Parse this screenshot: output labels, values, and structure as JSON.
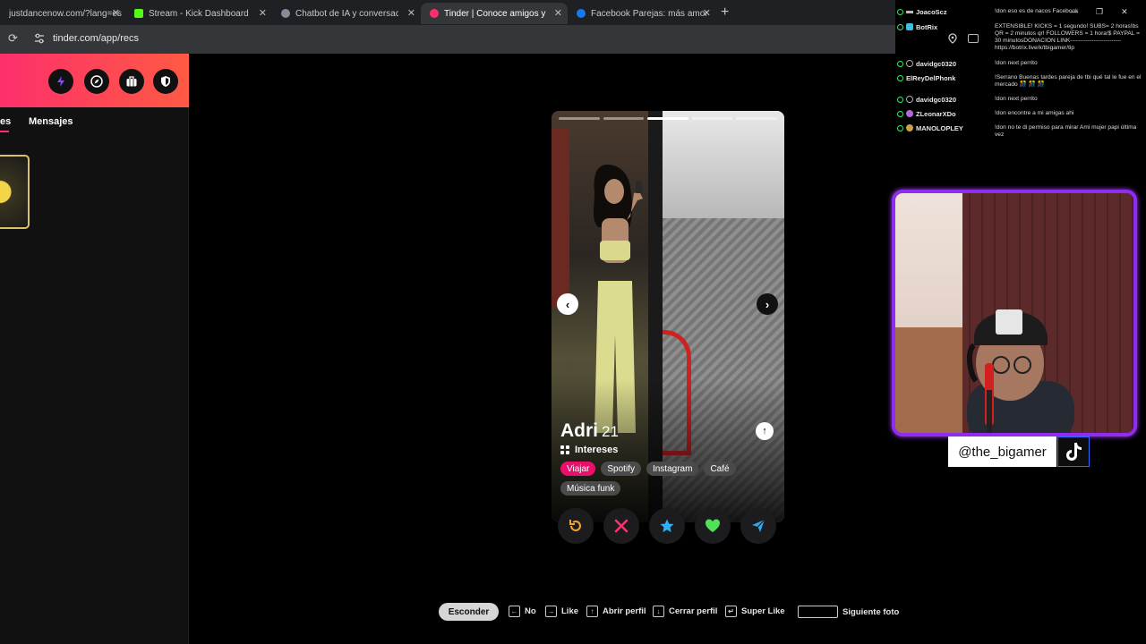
{
  "browser": {
    "tabs": [
      {
        "title": "justdancenow.com/?lang=es",
        "active": false
      },
      {
        "title": "Stream - Kick Dashboard",
        "active": false
      },
      {
        "title": "Chatbot de IA y conversaciones",
        "active": false
      },
      {
        "title": "Tinder | Conoce amigos y gente",
        "active": true
      },
      {
        "title": "Facebook Parejas: más amor",
        "active": false
      }
    ],
    "url": "tinder.com/app/recs"
  },
  "sidebar": {
    "tab_matches": "es",
    "tab_messages": "Mensajes"
  },
  "profile": {
    "name": "Adri",
    "age": "21",
    "interests_label": "Intereses",
    "interests": [
      "Viajar",
      "Spotify",
      "Instagram",
      "Café",
      "Música funk"
    ],
    "photo_count": 5,
    "current_photo": 3
  },
  "shortcuts": {
    "hide": "Esconder",
    "items": [
      "No",
      "Like",
      "Abrir perfil",
      "Cerrar perfil",
      "Super Like",
      "Siguiente foto"
    ]
  },
  "chat": {
    "messages": [
      {
        "user": "JoacoScz",
        "msg": "!don eso es de nacos Facebook"
      },
      {
        "user": "BotRix",
        "msg": "EXTENSIBLE! KICKS = 1 segundo! SUBS= 2 horas!bs QR = 2 minutos qr! FOLLOWERS = 1 hora!$ PAYPAL = 30 minutosDONACION LINK-------------------------- https://botrix.live/k/tbigamer/tip"
      },
      {
        "user": "davidgc0320",
        "msg": "!don next perrito"
      },
      {
        "user": "ElReyDelPhonk",
        "msg": "!Serrano Buenas tardes pareja de tbi qué tal le fue en el mercado 🎊 🎊 🎊"
      },
      {
        "user": "davidgc0320",
        "msg": "!don next perrito"
      },
      {
        "user": "ZLeonarXDo",
        "msg": "!don encontre a mi amigas ahi"
      },
      {
        "user": "MANOLOPLEY",
        "msg": "!don no te di permiso para mirar Ami mujer papi última vez"
      }
    ]
  },
  "stream": {
    "handle": "@the_bigamer"
  },
  "colors": {
    "tinder_gradient_start": "#fd2f6b",
    "tinder_gradient_end": "#ff5a44",
    "cam_border": "#8f2cf0",
    "chip_highlight": "#e8106a"
  }
}
